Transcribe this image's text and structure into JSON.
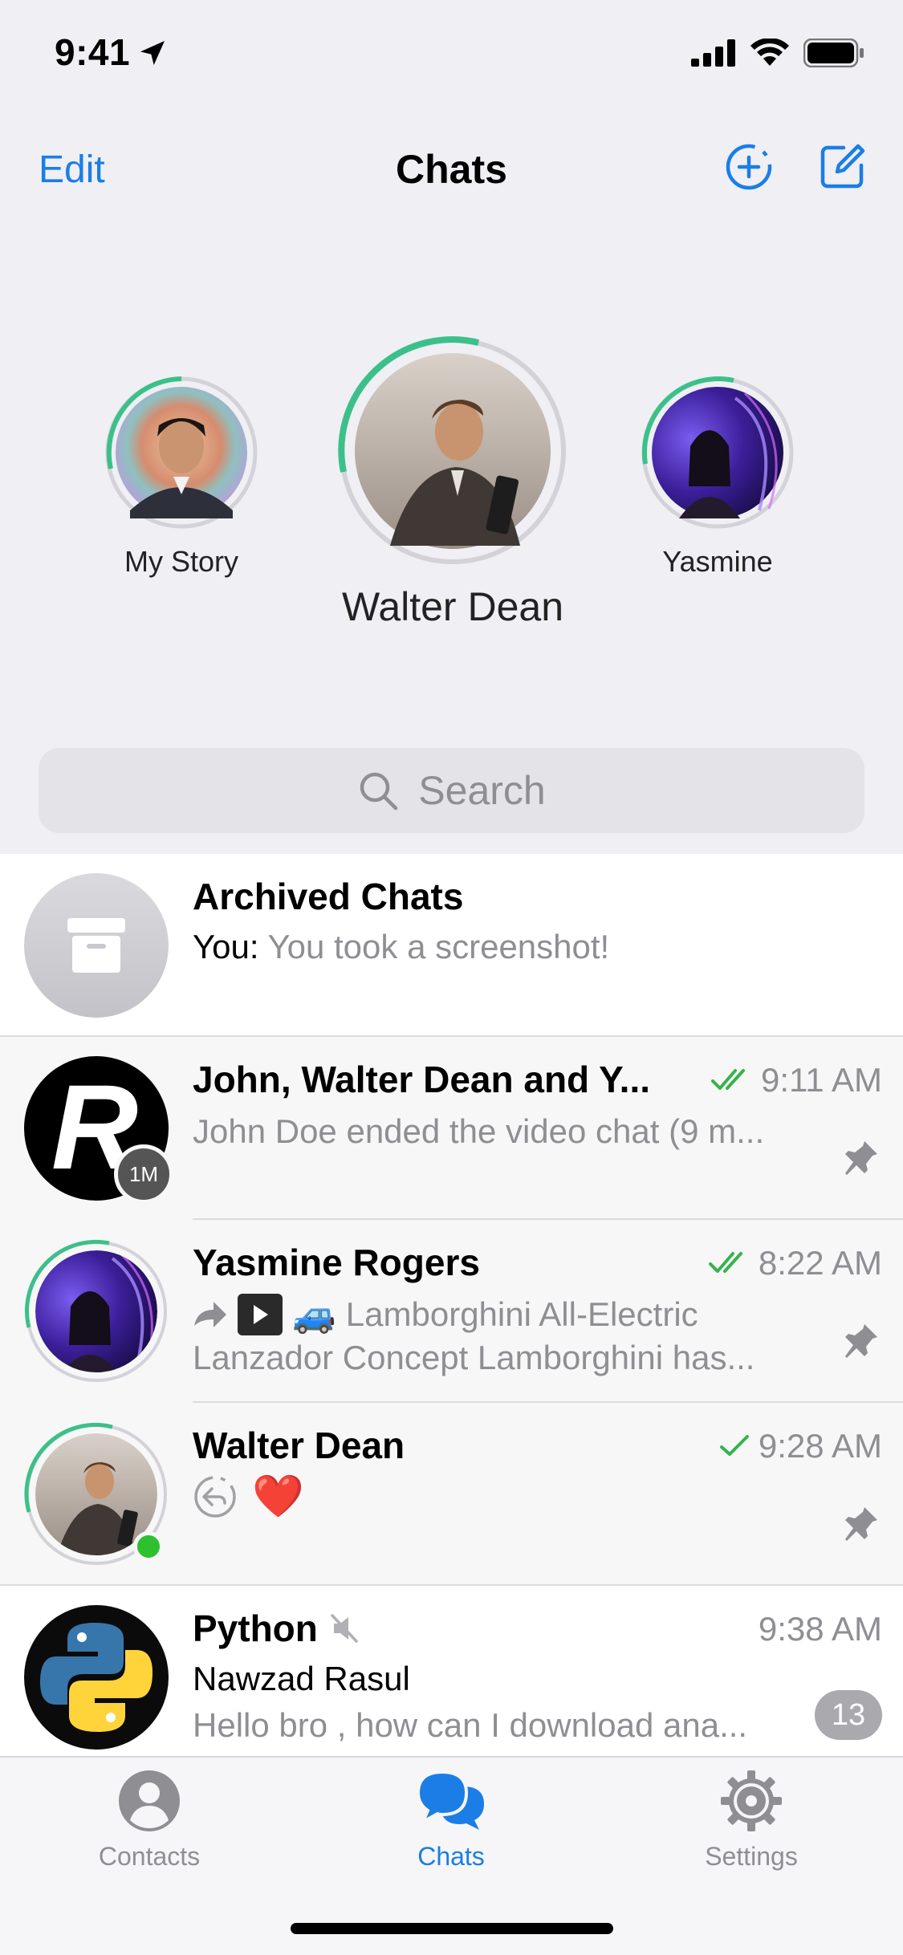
{
  "status": {
    "time": "9:41"
  },
  "nav": {
    "edit": "Edit",
    "title": "Chats"
  },
  "stories": [
    {
      "label": "My Story",
      "progress": 0.25
    },
    {
      "label": "Walter Dean",
      "progress": 0.3
    },
    {
      "label": "Yasmine",
      "progress": 0.25
    }
  ],
  "search": {
    "placeholder": "Search"
  },
  "chats": [
    {
      "title": "Archived Chats",
      "line1_prefix": "You:",
      "line1": "You took a screenshot!"
    },
    {
      "title": "John, Walter Dean and Y...",
      "time": "9:11 AM",
      "line1": "John Doe ended the video chat (9 m...",
      "timer_badge": "1M"
    },
    {
      "title": "Yasmine Rogers",
      "time": "8:22 AM",
      "line1": "Lamborghini All-Electric",
      "line2": "Lanzador Concept Lamborghini has...",
      "emoji": "🚙"
    },
    {
      "title": "Walter Dean",
      "time": "9:28 AM",
      "emoji": "❤️"
    },
    {
      "title": "Python",
      "time": "9:38 AM",
      "sender": "Nawzad Rasul",
      "line1": "Hello bro , how can I download ana...",
      "unread": "13"
    }
  ],
  "tabs": [
    {
      "label": "Contacts"
    },
    {
      "label": "Chats"
    },
    {
      "label": "Settings"
    }
  ],
  "colors": {
    "accent": "#1a7ee6",
    "read_check": "#37b24d",
    "story_ring": "#3cc08a",
    "online": "#2fc02f"
  }
}
